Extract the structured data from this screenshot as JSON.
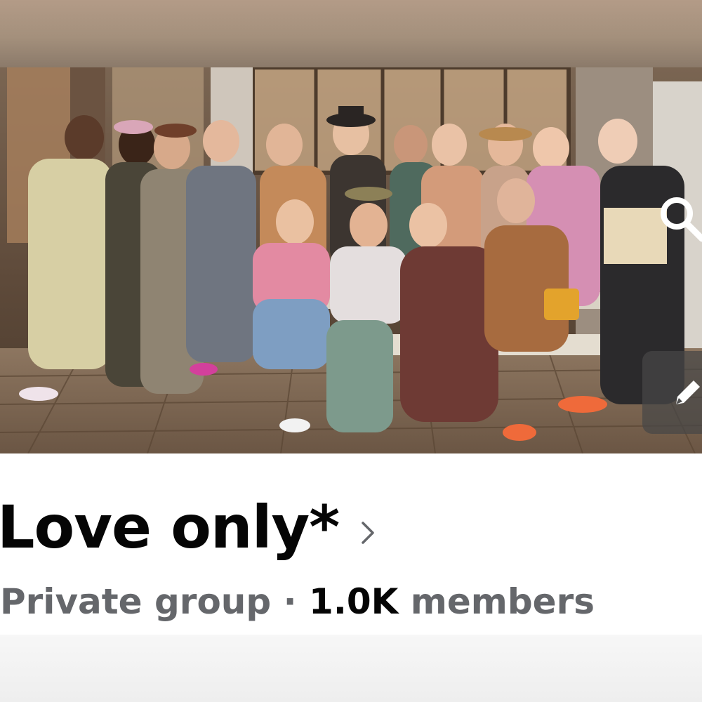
{
  "header": {
    "search_icon": "search-icon",
    "edit_icon": "pencil-icon"
  },
  "cover_photo": {
    "subject": "group-photo",
    "accent_wood": "#6f5a45",
    "accent_floor": "#8a735c"
  },
  "group": {
    "name": "Love only*",
    "privacy": "Private group",
    "separator": "·",
    "member_count": "1.0K",
    "members_label": "members"
  },
  "colors": {
    "title": "#050505",
    "secondary": "#65676b"
  }
}
